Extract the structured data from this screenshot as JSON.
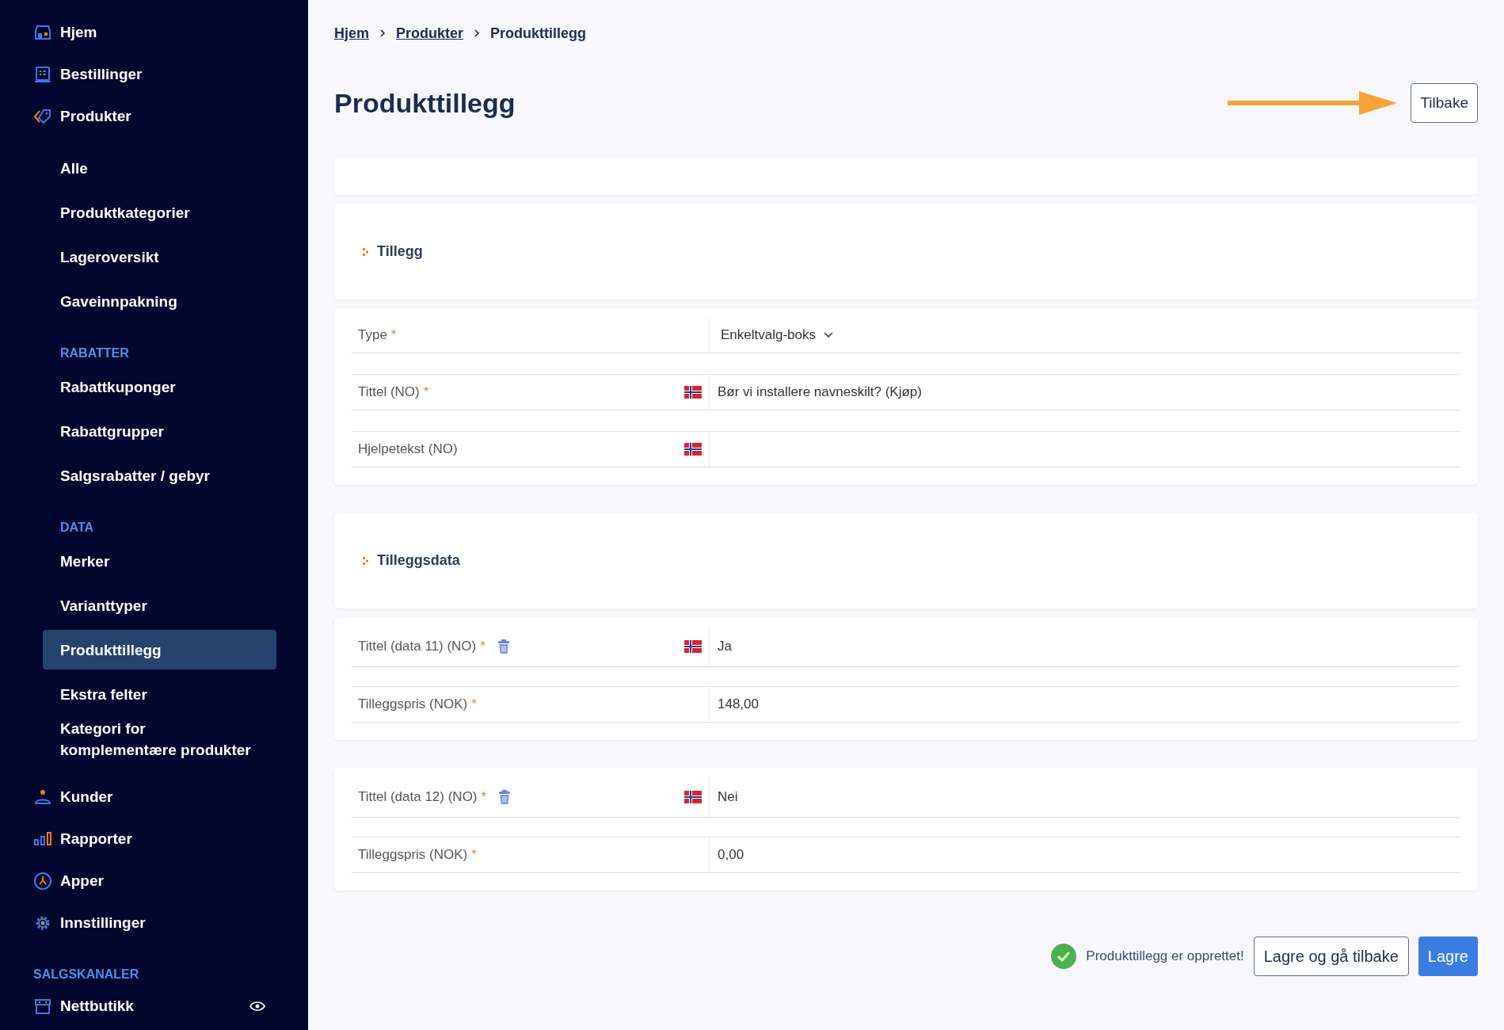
{
  "sidebar": {
    "items": [
      {
        "kind": "main",
        "label": "Hjem",
        "selected": false
      },
      {
        "kind": "main",
        "label": "Bestillinger",
        "selected": false
      },
      {
        "kind": "main",
        "label": "Produkter",
        "selected": false
      },
      {
        "kind": "sub",
        "label": "Alle",
        "selected": false
      },
      {
        "kind": "sub",
        "label": "Produktkategorier",
        "selected": false
      },
      {
        "kind": "sub",
        "label": "Lageroversikt",
        "selected": false
      },
      {
        "kind": "sub",
        "label": "Gaveinnpakning",
        "selected": false
      },
      {
        "kind": "section",
        "label": "RABATTER"
      },
      {
        "kind": "sub",
        "label": "Rabattkuponger",
        "selected": false
      },
      {
        "kind": "sub",
        "label": "Rabattgrupper",
        "selected": false
      },
      {
        "kind": "sub",
        "label": "Salgsrabatter / gebyr",
        "selected": false
      },
      {
        "kind": "section",
        "label": "DATA"
      },
      {
        "kind": "sub",
        "label": "Merker",
        "selected": false
      },
      {
        "kind": "sub",
        "label": "Varianttyper",
        "selected": false
      },
      {
        "kind": "sub",
        "label": "Produkttillegg",
        "selected": true
      },
      {
        "kind": "sub",
        "label": "Ekstra felter",
        "selected": false
      },
      {
        "kind": "sub",
        "label": "Kategori for komplementære produkter",
        "selected": false
      },
      {
        "kind": "main",
        "label": "Kunder",
        "selected": false
      },
      {
        "kind": "main",
        "label": "Rapporter",
        "selected": false
      },
      {
        "kind": "main",
        "label": "Apper",
        "selected": false
      },
      {
        "kind": "main",
        "label": "Innstillinger",
        "selected": false
      },
      {
        "kind": "group",
        "label": "SALGSKANALER"
      },
      {
        "kind": "channel",
        "label": "Nettbutikk",
        "selected": false
      }
    ]
  },
  "breadcrumb": [
    {
      "kind": "link",
      "label": "Hjem"
    },
    {
      "kind": "link",
      "label": "Produkter"
    },
    {
      "kind": "current",
      "label": "Produkttillegg"
    }
  ],
  "title": "Produkttillegg",
  "back_button": "Tilbake",
  "cards": [
    {
      "kind": "empty"
    },
    {
      "kind": "section",
      "heading": "Tillegg"
    },
    {
      "kind": "fields",
      "rows": [
        {
          "kind": "select",
          "label": "Type",
          "required_mark": "*",
          "flag": false,
          "trash": false,
          "value": "Enkeltvalg-boks"
        },
        {
          "kind": "text",
          "label": "Tittel (NO)",
          "required_mark": "*",
          "flag": true,
          "trash": false,
          "value": "Bør vi installere navneskilt? (Kjøp)"
        },
        {
          "kind": "text",
          "label": "Hjelpetekst (NO)",
          "flag": true,
          "trash": false
        }
      ]
    },
    {
      "kind": "section",
      "heading": "Tilleggsdata"
    },
    {
      "kind": "data",
      "rows": [
        {
          "kind": "text",
          "label": "Tittel (data 11) (NO)",
          "required_mark": "*",
          "flag": true,
          "trash": true,
          "value": "Ja"
        },
        {
          "kind": "text",
          "label": "Tilleggspris (NOK)",
          "required_mark": "*",
          "flag": false,
          "trash": false,
          "value": "148,00"
        }
      ]
    },
    {
      "kind": "data",
      "rows": [
        {
          "kind": "text",
          "label": "Tittel (data 12) (NO)",
          "required_mark": "*",
          "flag": true,
          "trash": true,
          "value": "Nei"
        },
        {
          "kind": "text",
          "label": "Tilleggspris (NOK)",
          "required_mark": "*",
          "flag": false,
          "trash": false,
          "value": "0,00"
        }
      ]
    }
  ],
  "footer": {
    "message": "Produkttillegg er opprettet!",
    "buttons": [
      {
        "kind": "secondary",
        "label": "Lagre og gå tilbake"
      },
      {
        "kind": "primary",
        "label": "Lagre"
      }
    ]
  }
}
